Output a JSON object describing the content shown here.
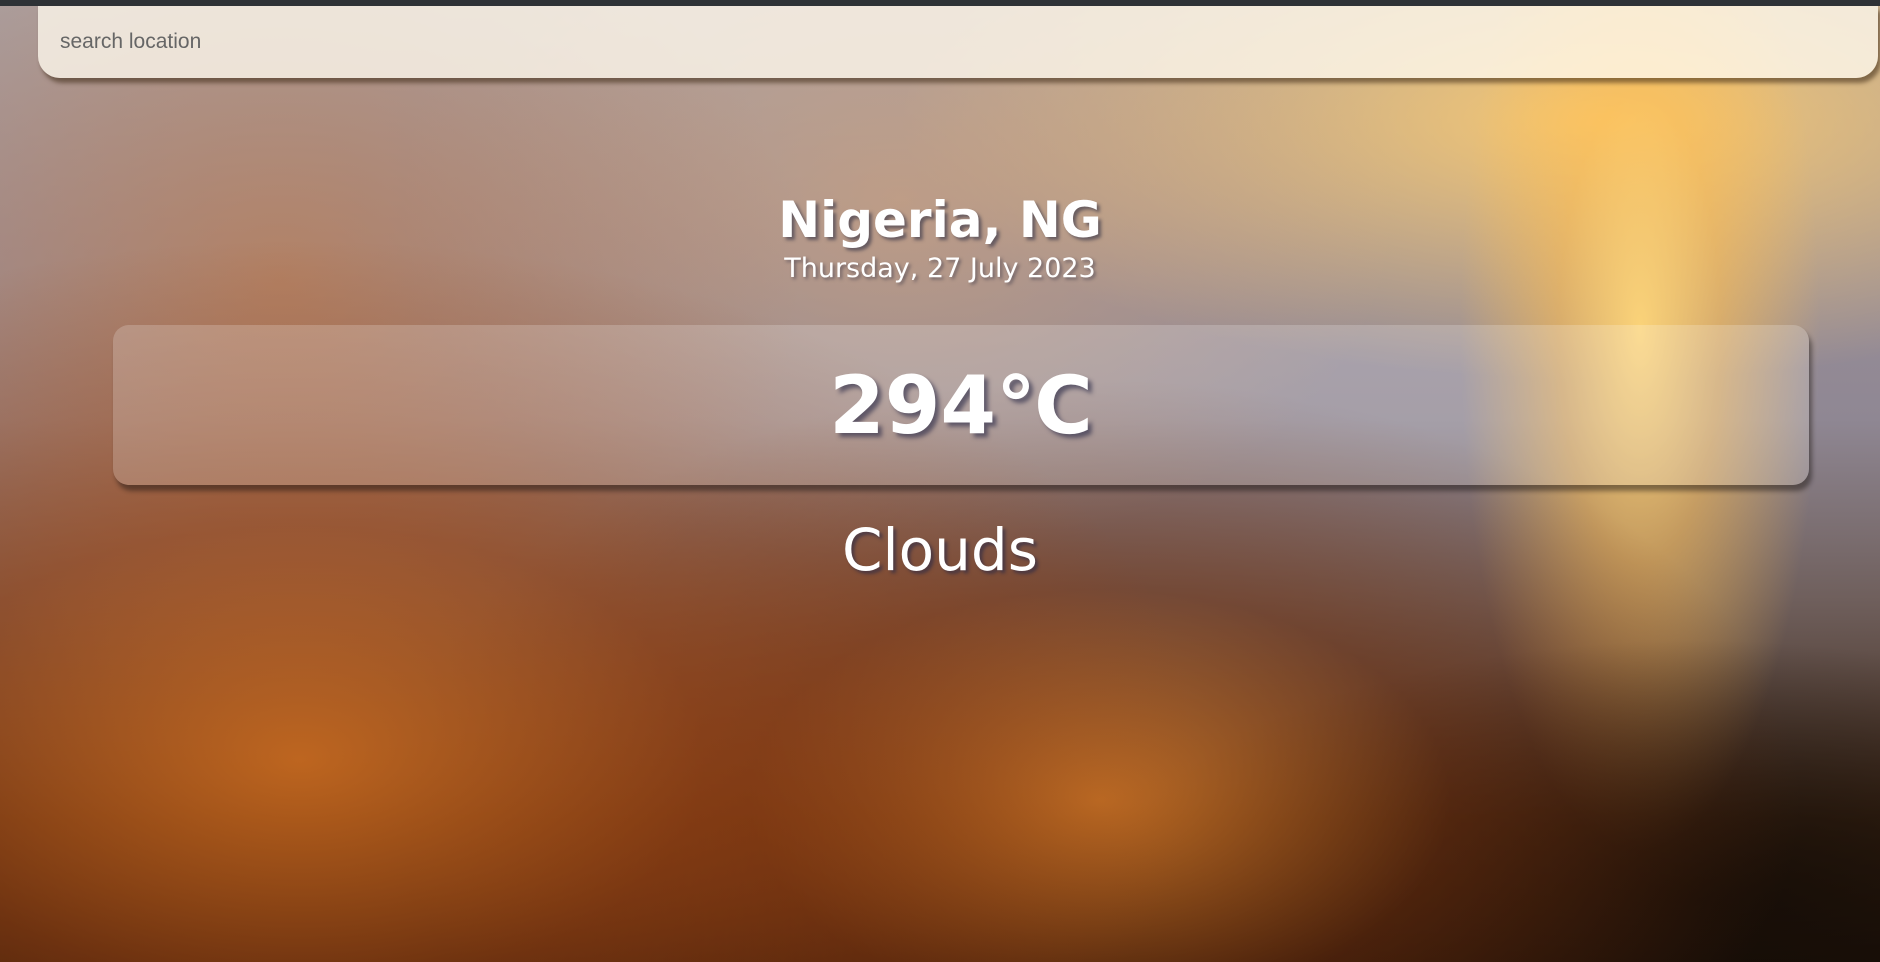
{
  "search": {
    "placeholder": "search location",
    "value": ""
  },
  "location": {
    "name": "Nigeria, NG",
    "date": "Thursday, 27 July 2023"
  },
  "weather": {
    "temperature": "294℃",
    "condition": "Clouds"
  },
  "colors": {
    "text": "#ffffff",
    "search_bg": "#fffaee"
  }
}
